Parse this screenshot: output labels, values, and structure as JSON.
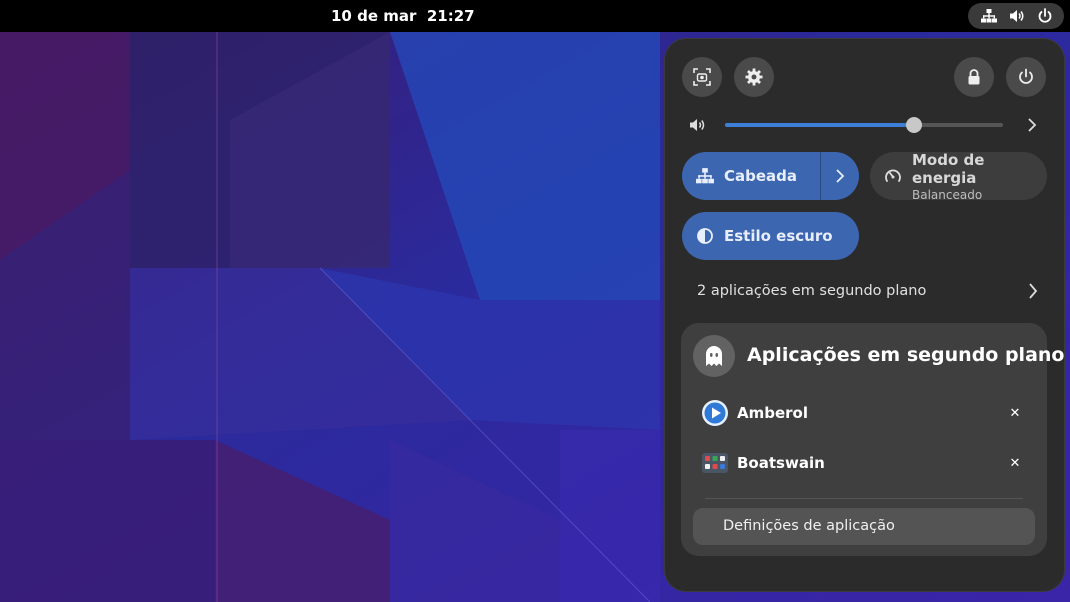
{
  "topbar": {
    "clock": "10 de mar  21:27",
    "icons": [
      "network-wired-icon",
      "volume-icon",
      "power-icon"
    ]
  },
  "quick_settings": {
    "top_buttons": [
      "screenshot-icon",
      "settings-gear-icon",
      "lock-icon",
      "power-icon"
    ],
    "volume": {
      "icon": "volume-icon",
      "level": 0.68
    },
    "toggles": {
      "wired": {
        "label": "Cabeada",
        "active": true
      },
      "power_mode": {
        "label": "Modo de energia",
        "subtitle": "Balanceado",
        "active": false
      },
      "dark_style": {
        "label": "Estilo escuro",
        "active": true
      }
    },
    "background_apps_label": "2 aplicações em segundo plano",
    "submenu": {
      "title": "Aplicações em segundo plano",
      "apps": [
        {
          "name": "Amberol",
          "icon": "amberol-icon"
        },
        {
          "name": "Boatswain",
          "icon": "boatswain-icon"
        }
      ],
      "settings_label": "Definições de aplicação"
    }
  },
  "colors": {
    "accent": "#3c67b0",
    "slider_fill": "#3d7fd6",
    "panel_bg": "#2b2b2b"
  }
}
